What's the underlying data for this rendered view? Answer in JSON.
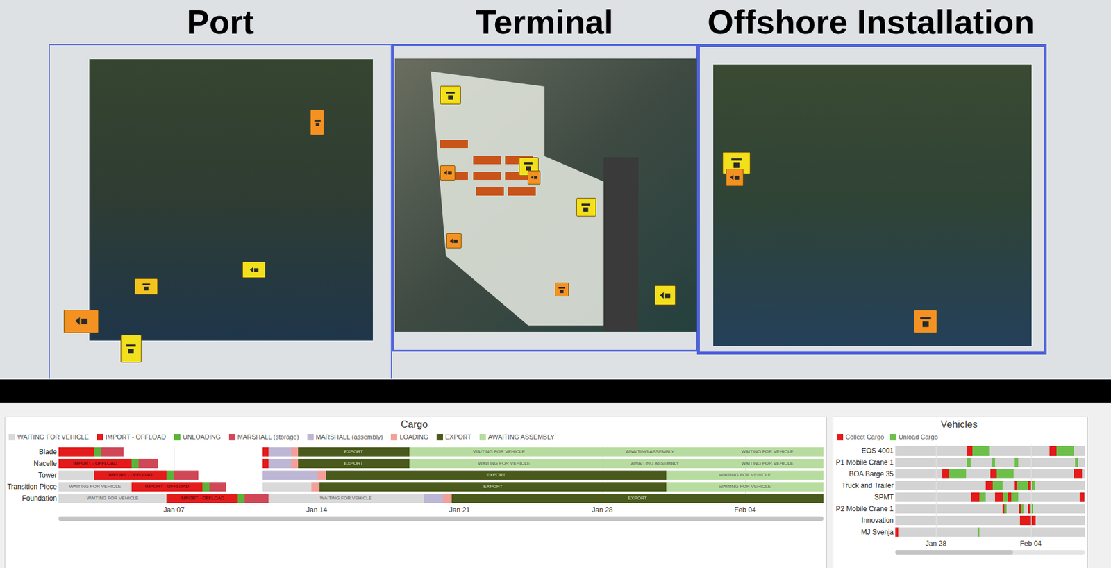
{
  "panels": [
    {
      "title": "Port",
      "pins": [
        {
          "color": "#f39222"
        },
        {
          "color": "#f2e01c"
        },
        {
          "color": "#f2c41c"
        },
        {
          "color": "#f39222"
        },
        {
          "color": "#f2e01c"
        }
      ]
    },
    {
      "title": "Terminal",
      "pins": [
        {
          "color": "#f2e01c"
        },
        {
          "color": "#f39222"
        },
        {
          "color": "#f2e01c"
        },
        {
          "color": "#f39222"
        },
        {
          "color": "#f2e01c"
        },
        {
          "color": "#f39222"
        },
        {
          "color": "#f39222"
        },
        {
          "color": "#f2e01c"
        }
      ]
    },
    {
      "title": "Offshore Installation",
      "pins": [
        {
          "color": "#f2e01c"
        },
        {
          "color": "#f39222"
        },
        {
          "color": "#f39222"
        }
      ]
    }
  ],
  "cargo": {
    "title": "Cargo",
    "legend": [
      {
        "kind": "waiting",
        "label": "WAITING FOR VEHICLE",
        "color": "#d9d9d9"
      },
      {
        "kind": "import",
        "label": "IMPORT - OFFLOAD",
        "color": "#e31b1b"
      },
      {
        "kind": "unloading",
        "label": "UNLOADING",
        "color": "#5bb339"
      },
      {
        "kind": "storage",
        "label": "MARSHALL (storage)",
        "color": "#d04858"
      },
      {
        "kind": "assembly",
        "label": "MARSHALL (assembly)",
        "color": "#bdb7d5"
      },
      {
        "kind": "loading",
        "label": "LOADING",
        "color": "#f4a09a"
      },
      {
        "kind": "export",
        "label": "EXPORT",
        "color": "#4a5a1c"
      },
      {
        "kind": "awaiting",
        "label": "AWAITING ASSEMBLY",
        "color": "#b8dca0"
      }
    ],
    "axis": {
      "start": 0,
      "end": 37.5,
      "ticks": [
        {
          "label": "Jan 07",
          "at": 5.66
        },
        {
          "label": "Jan 14",
          "at": 12.66
        },
        {
          "label": "Jan 21",
          "at": 19.66
        },
        {
          "label": "Jan 28",
          "at": 26.66
        },
        {
          "label": "Feb 04",
          "at": 33.66
        }
      ]
    },
    "scroll": {
      "level": 1
    },
    "rows": [
      {
        "name": "Blade",
        "segments": [
          {
            "kind": "import",
            "start": 0,
            "end": 1.74
          },
          {
            "kind": "unloading",
            "start": 1.74,
            "end": 2.08
          },
          {
            "kind": "storage",
            "start": 2.08,
            "end": 3.19
          },
          {
            "kind": "import",
            "start": 10,
            "end": 10.28
          },
          {
            "kind": "assembly",
            "start": 10.28,
            "end": 11.39
          },
          {
            "kind": "loading",
            "start": 11.39,
            "end": 11.74
          },
          {
            "kind": "export",
            "start": 11.74,
            "end": 17.19,
            "label": "EXPORT"
          },
          {
            "kind": "awaiting",
            "start": 17.19,
            "end": 26,
            "label": "WAITING FOR VEHICLE"
          },
          {
            "kind": "awaiting",
            "start": 26,
            "end": 32,
            "label": "AWAITING ASSEMBLY"
          },
          {
            "kind": "awaiting",
            "start": 32,
            "end": 37.5,
            "label": "WAITING FOR VEHICLE"
          }
        ]
      },
      {
        "name": "Nacelle",
        "segments": [
          {
            "kind": "import",
            "start": 0,
            "end": 3.58,
            "label": "IMPORT - OFFLOAD"
          },
          {
            "kind": "unloading",
            "start": 3.58,
            "end": 3.92
          },
          {
            "kind": "storage",
            "start": 3.92,
            "end": 4.86
          },
          {
            "kind": "import",
            "start": 10,
            "end": 10.28
          },
          {
            "kind": "assembly",
            "start": 10.28,
            "end": 11.39
          },
          {
            "kind": "loading",
            "start": 11.39,
            "end": 11.74
          },
          {
            "kind": "export",
            "start": 11.74,
            "end": 17.19,
            "label": "EXPORT"
          },
          {
            "kind": "awaiting",
            "start": 17.19,
            "end": 26.5,
            "label": "WAITING FOR VEHICLE"
          },
          {
            "kind": "awaiting",
            "start": 26.5,
            "end": 32,
            "label": "AWAITING ASSEMBLY"
          },
          {
            "kind": "awaiting",
            "start": 32,
            "end": 37.5,
            "label": "WAITING FOR VEHICLE"
          }
        ]
      },
      {
        "name": "Tower",
        "segments": [
          {
            "kind": "waiting",
            "start": 0,
            "end": 1.74
          },
          {
            "kind": "import",
            "start": 1.74,
            "end": 5.3,
            "label": "IMPORT - OFFLOAD"
          },
          {
            "kind": "unloading",
            "start": 5.3,
            "end": 5.66
          },
          {
            "kind": "storage",
            "start": 5.66,
            "end": 6.84
          },
          {
            "kind": "assembly",
            "start": 10,
            "end": 12.7
          },
          {
            "kind": "loading",
            "start": 12.7,
            "end": 13.1
          },
          {
            "kind": "export",
            "start": 13.1,
            "end": 29.8,
            "label": "EXPORT"
          },
          {
            "kind": "awaiting",
            "start": 29.8,
            "end": 37.5,
            "label": "WAITING FOR VEHICLE"
          }
        ]
      },
      {
        "name": "Transition Piece",
        "segments": [
          {
            "kind": "waiting",
            "start": 0,
            "end": 3.58,
            "label": "WAITING FOR VEHICLE"
          },
          {
            "kind": "import",
            "start": 3.58,
            "end": 7.05,
            "label": "IMPORT - OFFLOAD"
          },
          {
            "kind": "unloading",
            "start": 7.05,
            "end": 7.4
          },
          {
            "kind": "storage",
            "start": 7.4,
            "end": 8.23
          },
          {
            "kind": "waiting",
            "start": 10,
            "end": 12.4
          },
          {
            "kind": "loading",
            "start": 12.4,
            "end": 12.8
          },
          {
            "kind": "export",
            "start": 12.8,
            "end": 29.8,
            "label": "EXPORT"
          },
          {
            "kind": "awaiting",
            "start": 29.8,
            "end": 37.5,
            "label": "WAITING FOR VEHICLE"
          }
        ]
      },
      {
        "name": "Foundation",
        "segments": [
          {
            "kind": "waiting",
            "start": 0,
            "end": 5.3,
            "label": "WAITING FOR VEHICLE"
          },
          {
            "kind": "import",
            "start": 5.3,
            "end": 8.78,
            "label": "IMPORT - OFFLOAD"
          },
          {
            "kind": "unloading",
            "start": 8.78,
            "end": 9.13
          },
          {
            "kind": "storage",
            "start": 9.13,
            "end": 10.28
          },
          {
            "kind": "waiting",
            "start": 10.28,
            "end": 17.9,
            "label": "WAITING FOR VEHICLE"
          },
          {
            "kind": "assembly",
            "start": 17.9,
            "end": 18.85
          },
          {
            "kind": "loading",
            "start": 18.85,
            "end": 19.27
          },
          {
            "kind": "export",
            "start": 19.27,
            "end": 37.5,
            "label": "EXPORT"
          }
        ]
      }
    ]
  },
  "vehicles": {
    "title": "Vehicles",
    "legend": [
      {
        "kind": "collect",
        "label": "Collect Cargo",
        "color": "#e31b1b"
      },
      {
        "kind": "unload",
        "label": "Unload Cargo",
        "color": "#6cc04a"
      }
    ],
    "axis": {
      "start": 0,
      "end": 14,
      "ticks": [
        {
          "label": "Jan 28",
          "at": 3
        },
        {
          "label": "Feb 04",
          "at": 10
        }
      ]
    },
    "scroll": {
      "level": 0.62
    },
    "rows": [
      {
        "name": "EOS 4001",
        "segments": [
          {
            "kind": "collect",
            "start": 5.28,
            "end": 5.7
          },
          {
            "kind": "unload",
            "start": 5.7,
            "end": 7.0
          },
          {
            "kind": "collect",
            "start": 11.4,
            "end": 11.9
          },
          {
            "kind": "unload",
            "start": 11.9,
            "end": 13.2
          }
        ]
      },
      {
        "name": "P1 Mobile Crane 1",
        "segments": [
          {
            "kind": "unload",
            "start": 5.3,
            "end": 5.55
          },
          {
            "kind": "unload",
            "start": 7.1,
            "end": 7.35
          },
          {
            "kind": "unload",
            "start": 8.8,
            "end": 9.07
          },
          {
            "kind": "unload",
            "start": 13.26,
            "end": 13.5
          }
        ]
      },
      {
        "name": "BOA Barge 35",
        "segments": [
          {
            "kind": "collect",
            "start": 3.47,
            "end": 3.94
          },
          {
            "kind": "unload",
            "start": 3.94,
            "end": 5.23
          },
          {
            "kind": "collect",
            "start": 7.0,
            "end": 7.5
          },
          {
            "kind": "unload",
            "start": 7.5,
            "end": 8.75
          },
          {
            "kind": "collect",
            "start": 13.2,
            "end": 13.8
          }
        ]
      },
      {
        "name": "Truck and Trailer",
        "segments": [
          {
            "kind": "collect",
            "start": 6.7,
            "end": 7.2
          },
          {
            "kind": "unload",
            "start": 7.2,
            "end": 7.9
          },
          {
            "kind": "collect",
            "start": 8.8,
            "end": 9.0
          },
          {
            "kind": "unload",
            "start": 9.0,
            "end": 9.8
          },
          {
            "kind": "collect",
            "start": 9.8,
            "end": 10.05
          },
          {
            "kind": "unload",
            "start": 10.05,
            "end": 10.3
          }
        ]
      },
      {
        "name": "SPMT",
        "segments": [
          {
            "kind": "collect",
            "start": 5.6,
            "end": 6.2
          },
          {
            "kind": "unload",
            "start": 6.2,
            "end": 6.7
          },
          {
            "kind": "collect",
            "start": 7.36,
            "end": 7.98
          },
          {
            "kind": "unload",
            "start": 7.98,
            "end": 8.3
          },
          {
            "kind": "collect",
            "start": 8.3,
            "end": 8.55
          },
          {
            "kind": "unload",
            "start": 8.55,
            "end": 9.07
          },
          {
            "kind": "collect",
            "start": 13.6,
            "end": 13.94
          }
        ]
      },
      {
        "name": "P2 Mobile Crane 1",
        "segments": [
          {
            "kind": "collect",
            "start": 7.93,
            "end": 8.05
          },
          {
            "kind": "unload",
            "start": 8.05,
            "end": 8.2
          },
          {
            "kind": "collect",
            "start": 9.1,
            "end": 9.3
          },
          {
            "kind": "unload",
            "start": 9.3,
            "end": 9.45
          },
          {
            "kind": "collect",
            "start": 9.8,
            "end": 9.95
          },
          {
            "kind": "unload",
            "start": 9.95,
            "end": 10.15
          }
        ]
      },
      {
        "name": "Innovation",
        "segments": [
          {
            "kind": "collect",
            "start": 9.2,
            "end": 10.36
          }
        ]
      },
      {
        "name": "MJ Svenja",
        "segments": [
          {
            "kind": "collect",
            "start": 0,
            "end": 0.2
          },
          {
            "kind": "unload",
            "start": 6.06,
            "end": 6.2
          }
        ]
      }
    ]
  }
}
